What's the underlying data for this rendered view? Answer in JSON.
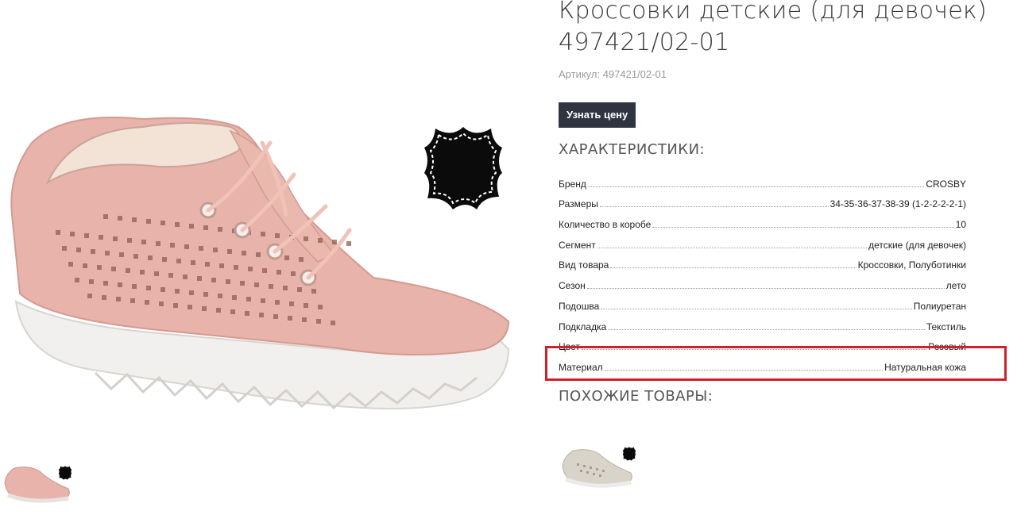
{
  "product": {
    "title_line1": "Кроссовки детские (для девочек)",
    "title_line2": "497421/02-01",
    "article_label": "Артикул: 497421/02-01",
    "price_button": "Узнать цену"
  },
  "specs": {
    "heading": "ХАРАКТЕРИСТИКИ:",
    "rows": [
      {
        "key": "Бренд",
        "value": "CROSBY"
      },
      {
        "key": "Размеры",
        "value": "34-35-36-37-38-39 (1-2-2-2-2-1)"
      },
      {
        "key": "Количество в коробе",
        "value": "10"
      },
      {
        "key": "Сегмент",
        "value": "детские (для девочек)"
      },
      {
        "key": "Вид товара",
        "value": "Кроссовки, Полуботинки"
      },
      {
        "key": "Сезон",
        "value": "лето"
      },
      {
        "key": "Подошва",
        "value": "Полиуретан"
      },
      {
        "key": "Подкладка",
        "value": "Текстиль"
      },
      {
        "key": "Цвет",
        "value": "Розовый"
      },
      {
        "key": "Материал",
        "value": "Натуральная кожа"
      }
    ]
  },
  "similar": {
    "heading": "ПОХОЖИЕ ТОВАРЫ:"
  },
  "icons": {
    "leather": "leather-hide-icon"
  },
  "colors": {
    "button_bg": "#2f3440",
    "highlight": "#d0202a",
    "shoe_pink": "#e8b3aa"
  }
}
